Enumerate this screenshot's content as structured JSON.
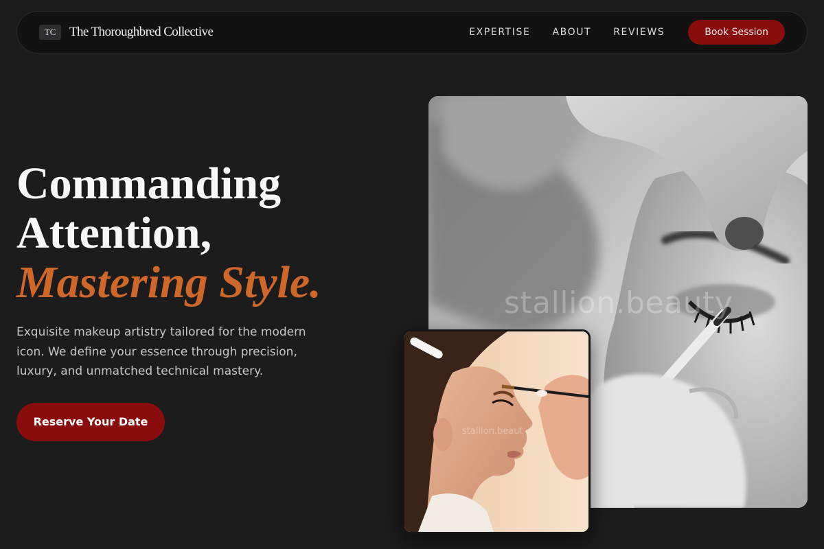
{
  "nav": {
    "logo_mark": "TC",
    "brand_name": "The Thoroughbred Collective",
    "links": [
      "EXPERTISE",
      "ABOUT",
      "REVIEWS"
    ],
    "cta_label": "Book Session"
  },
  "hero": {
    "headline_line1": "Commanding",
    "headline_line2": "Attention,",
    "headline_accent": "Mastering Style.",
    "subtext": "Exquisite makeup artistry tailored for the modern icon. We define your essence through precision, luxury, and unmatched technical mastery.",
    "cta_label": "Reserve Your Date"
  },
  "images": {
    "main_watermark": "stallion.beauty",
    "inset_watermark": "stallion.beaut"
  },
  "colors": {
    "background": "#1c1c1d",
    "accent_red": "#8a0d0d",
    "accent_orange": "#d0672a"
  }
}
